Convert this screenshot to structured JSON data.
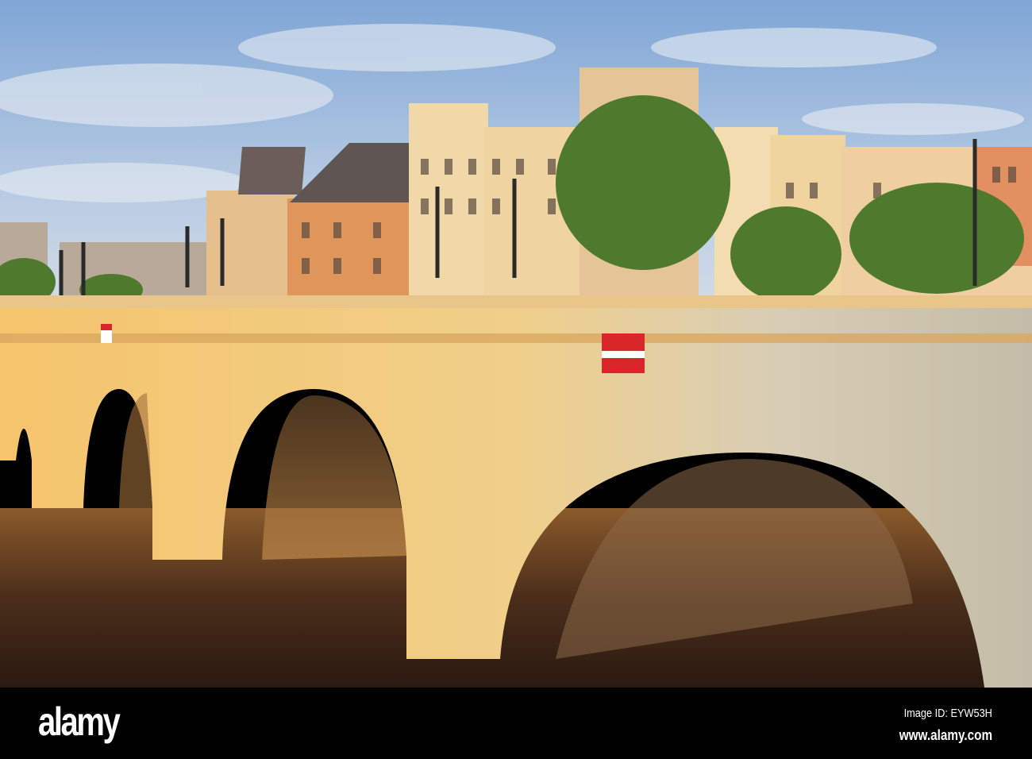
{
  "watermark": {
    "logo": "alamy",
    "image_id": "Image ID: EYW53H",
    "website": "www.alamy.com"
  },
  "colors": {
    "sky_top": "#7fa6d6",
    "sky_bottom": "#c9d9ea",
    "stone_lit": "#f2c777",
    "stone_shade": "#c9bfa8",
    "water": "#4a2e1a",
    "footer": "#000000"
  }
}
